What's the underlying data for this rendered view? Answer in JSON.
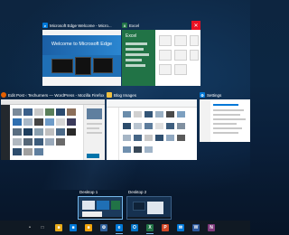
{
  "windows": {
    "edge": {
      "title": "Microsoft Edge Welcome - Micro...",
      "hero_text": "Welcome to Microsoft Edge",
      "icon": "edge-icon",
      "icon_color": "#0078d7"
    },
    "excel": {
      "title": "Excel",
      "left_heading": "Excel",
      "icon": "excel-icon",
      "icon_color": "#217346"
    },
    "firefox": {
      "title": "Edit Post ‹ Techurners — WordPress - Mozilla Firefox",
      "icon": "firefox-icon",
      "icon_color": "#e66000"
    },
    "explorer": {
      "title": "Blog Images",
      "icon": "folder-icon",
      "icon_color": "#f0c040"
    },
    "settings": {
      "title": "Settings",
      "icon": "gear-icon",
      "icon_color": "#0078d7"
    }
  },
  "desktops": [
    {
      "label": "Desktop 1",
      "active": true
    },
    {
      "label": "Desktop 2",
      "active": false
    }
  ],
  "taskbar": {
    "icons": [
      {
        "name": "cortana-mic-icon",
        "glyph": "•",
        "color": "#101923"
      },
      {
        "name": "task-view-icon",
        "glyph": "□",
        "color": "#101923"
      },
      {
        "name": "file-explorer-icon",
        "glyph": "■",
        "color": "#e7a917"
      },
      {
        "name": "store-icon",
        "glyph": "■",
        "color": "#0078d7"
      },
      {
        "name": "sticky-app-icon",
        "glyph": "■",
        "color": "#f0a30a"
      },
      {
        "name": "settings-app-icon",
        "glyph": "⚙",
        "color": "#2d5f9a"
      },
      {
        "name": "edge-icon",
        "glyph": "e",
        "color": "#0078d7"
      },
      {
        "name": "outlook-icon",
        "glyph": "O",
        "color": "#0072c6"
      },
      {
        "name": "excel-icon",
        "glyph": "X",
        "color": "#217346"
      },
      {
        "name": "powerpoint-icon",
        "glyph": "P",
        "color": "#d24726"
      },
      {
        "name": "mail-icon",
        "glyph": "✉",
        "color": "#0078d7"
      },
      {
        "name": "word-icon",
        "glyph": "W",
        "color": "#2b579a"
      },
      {
        "name": "onenote-icon",
        "glyph": "N",
        "color": "#80397b"
      }
    ]
  }
}
